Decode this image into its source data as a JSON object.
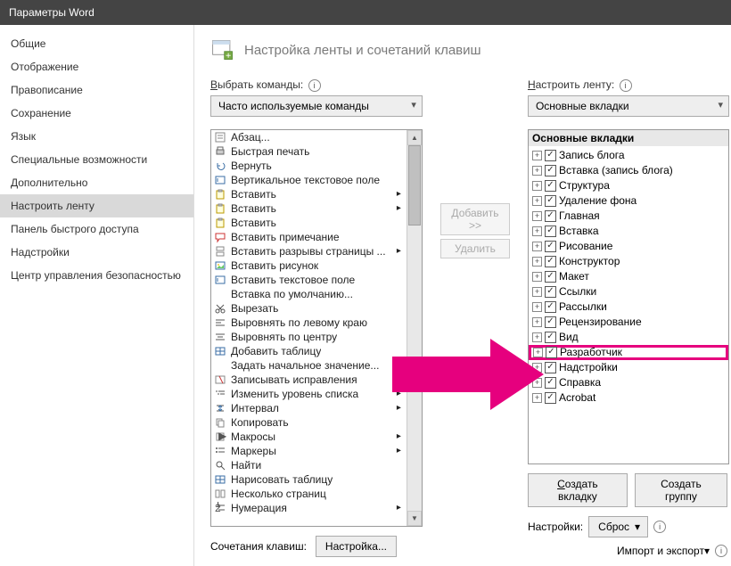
{
  "window": {
    "title": "Параметры Word"
  },
  "sidebar": {
    "items": [
      {
        "label": "Общие"
      },
      {
        "label": "Отображение"
      },
      {
        "label": "Правописание"
      },
      {
        "label": "Сохранение"
      },
      {
        "label": "Язык"
      },
      {
        "label": "Специальные возможности"
      },
      {
        "label": "Дополнительно"
      },
      {
        "label": "Настроить ленту",
        "selected": true
      },
      {
        "label": "Панель быстрого доступа"
      },
      {
        "label": "Надстройки"
      },
      {
        "label": "Центр управления безопасностью"
      }
    ]
  },
  "main": {
    "title": "Настройка ленты и сочетаний клавиш",
    "left_label": "Выбрать команды:",
    "left_label_u": "В",
    "left_dropdown": "Часто используемые команды",
    "right_label_u": "Н",
    "right_label_rest": "астроить ленту:",
    "right_dropdown": "Основные вкладки",
    "tree_header": "Основные вкладки",
    "commands": [
      {
        "icon": "para",
        "label": "Абзац..."
      },
      {
        "icon": "print",
        "label": "Быстрая печать"
      },
      {
        "icon": "undo",
        "label": "Вернуть"
      },
      {
        "icon": "textbox",
        "label": "Вертикальное текстовое поле"
      },
      {
        "icon": "paste",
        "label": "Вставить",
        "sub": "▸"
      },
      {
        "icon": "paste",
        "label": "Вставить",
        "sub": "▸"
      },
      {
        "icon": "paste",
        "label": "Вставить"
      },
      {
        "icon": "comment",
        "label": "Вставить примечание"
      },
      {
        "icon": "break",
        "label": "Вставить разрывы страницы ...",
        "sub": "▸"
      },
      {
        "icon": "image",
        "label": "Вставить рисунок"
      },
      {
        "icon": "textbox",
        "label": "Вставить текстовое поле"
      },
      {
        "icon": "none",
        "label": "Вставка по умолчанию..."
      },
      {
        "icon": "cut",
        "label": "Вырезать"
      },
      {
        "icon": "alignl",
        "label": "Выровнять по левому краю"
      },
      {
        "icon": "alignc",
        "label": "Выровнять по центру"
      },
      {
        "icon": "table",
        "label": "Добавить таблицу"
      },
      {
        "icon": "none",
        "label": "Задать начальное значение...",
        "sub": "▸"
      },
      {
        "icon": "track",
        "label": "Записывать исправления",
        "sub": "▸"
      },
      {
        "icon": "list",
        "label": "Изменить уровень списка",
        "sub": "▸"
      },
      {
        "icon": "spacing",
        "label": "Интервал",
        "sub": "▸"
      },
      {
        "icon": "copy",
        "label": "Копировать"
      },
      {
        "icon": "macro",
        "label": "Макросы",
        "sub": "▸"
      },
      {
        "icon": "bullets",
        "label": "Маркеры",
        "sub": "▸"
      },
      {
        "icon": "find",
        "label": "Найти"
      },
      {
        "icon": "table",
        "label": "Нарисовать таблицу"
      },
      {
        "icon": "pages",
        "label": "Несколько страниц"
      },
      {
        "icon": "numbering",
        "label": "Нумерация",
        "sub": "▸"
      }
    ],
    "tree": [
      {
        "label": "Запись блога",
        "checked": true
      },
      {
        "label": "Вставка (запись блога)",
        "checked": true
      },
      {
        "label": "Структура",
        "checked": true
      },
      {
        "label": "Удаление фона",
        "checked": true
      },
      {
        "label": "Главная",
        "checked": true
      },
      {
        "label": "Вставка",
        "checked": true
      },
      {
        "label": "Рисование",
        "checked": true
      },
      {
        "label": "Конструктор",
        "checked": true
      },
      {
        "label": "Макет",
        "checked": true
      },
      {
        "label": "Ссылки",
        "checked": true
      },
      {
        "label": "Рассылки",
        "checked": true
      },
      {
        "label": "Рецензирование",
        "checked": true
      },
      {
        "label": "Вид",
        "checked": true
      },
      {
        "label": "Разработчик",
        "checked": true,
        "highlight": true
      },
      {
        "label": "Надстройки",
        "checked": true,
        "obscured": true
      },
      {
        "label": "Справка",
        "checked": true
      },
      {
        "label": "Acrobat",
        "checked": true
      }
    ],
    "mid": {
      "add": "Добавить >>",
      "remove": "Удалить"
    },
    "buttons": {
      "new_tab_u": "С",
      "new_tab_rest": "оздать вкладку",
      "new_group": "Создать группу",
      "reset_pre": "С",
      "reset_u": "б",
      "reset_post": "рос",
      "settings_label": "Настройки:",
      "import_pre": "И",
      "import_u": "м",
      "import_post": "порт и экспорт"
    },
    "shortcuts": {
      "label": "Сочетания клавиш:",
      "button": "Настройка..."
    }
  }
}
